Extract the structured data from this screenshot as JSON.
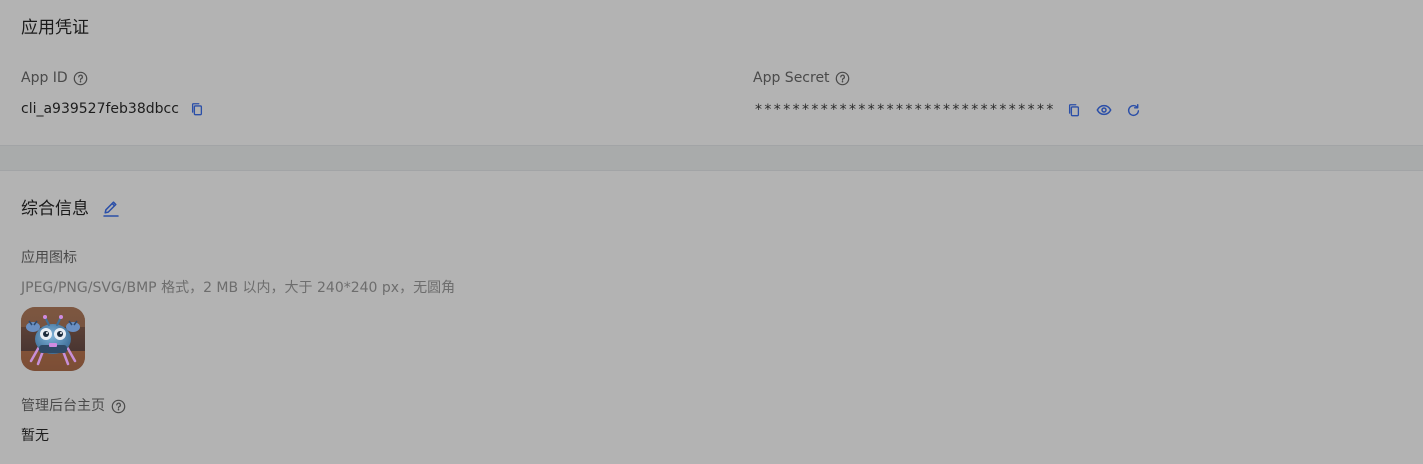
{
  "credentials": {
    "title": "应用凭证",
    "app_id": {
      "label": "App ID",
      "value": "cli_a939527feb38dbcc"
    },
    "app_secret": {
      "label": "App Secret",
      "value": "********************************"
    }
  },
  "general": {
    "title": "综合信息",
    "app_icon": {
      "label": "应用图标",
      "hint": "JPEG/PNG/SVG/BMP 格式，2 MB 以内，大于 240*240 px，无圆角"
    },
    "admin_homepage": {
      "label": "管理后台主页",
      "value": "暂无"
    }
  },
  "colors": {
    "accent": "#2b4fa8",
    "background": "#b3b3b3",
    "divider_band": "#a9abab"
  },
  "icons": {
    "help": "question-circle-icon",
    "copy": "copy-icon",
    "view": "eye-icon",
    "reset": "refresh-icon",
    "edit": "pencil-icon"
  }
}
